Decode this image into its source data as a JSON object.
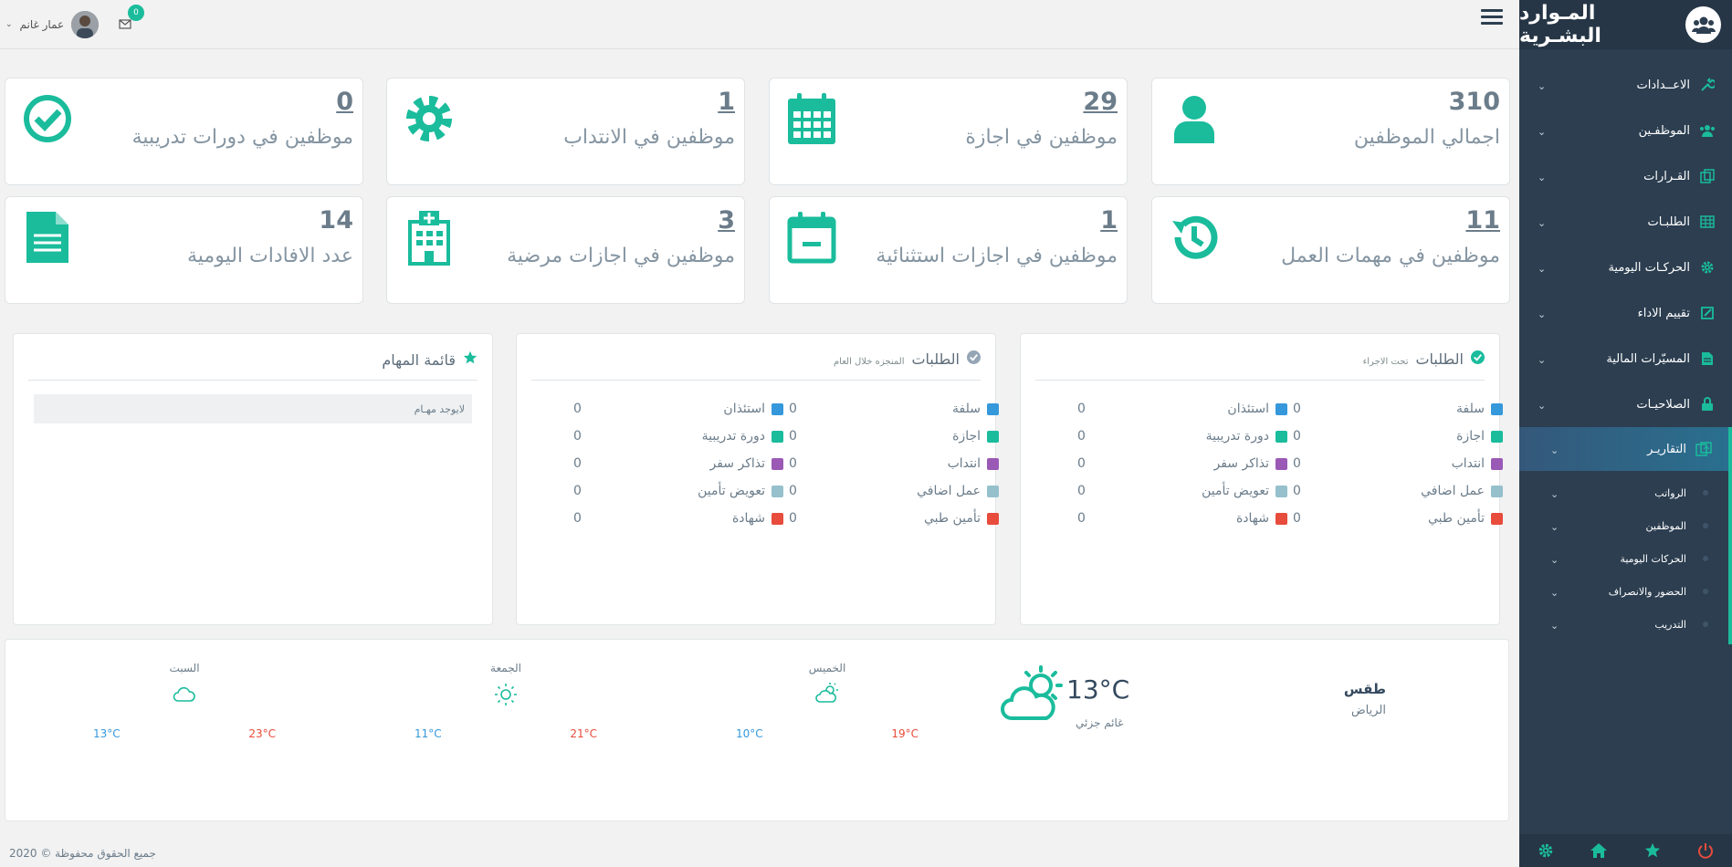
{
  "brand": {
    "title": "المـوارد البشـرية",
    "icon": "users-icon"
  },
  "topbar": {
    "user_name": "عمار غانم",
    "mail_count": "0"
  },
  "sidebar": {
    "items": [
      {
        "label": "الاعــدادات",
        "icon": "wrench-icon"
      },
      {
        "label": "الموظفـين",
        "icon": "users-icon"
      },
      {
        "label": "القـرارات",
        "icon": "copy-icon"
      },
      {
        "label": "الطلبـات",
        "icon": "table-icon"
      },
      {
        "label": "الحركـات اليومية",
        "icon": "gear-icon"
      },
      {
        "label": "تقييم الاداء",
        "icon": "edit-icon"
      },
      {
        "label": "المسيّرات المالية",
        "icon": "document-icon"
      },
      {
        "label": "الصلاحيـات",
        "icon": "lock-icon"
      },
      {
        "label": "التقاريـر",
        "icon": "reports-icon"
      }
    ],
    "subitems": [
      {
        "label": "الرواتب"
      },
      {
        "label": "الموظفين"
      },
      {
        "label": "الحركات اليومية"
      },
      {
        "label": "الحضور والانصراف"
      },
      {
        "label": "التدريب"
      }
    ]
  },
  "stats": [
    {
      "num": "310",
      "label": "اجمالي الموظفين",
      "icon": "user-icon",
      "underline": false
    },
    {
      "num": "29",
      "label": "موظفين في اجازة",
      "icon": "calendar-icon",
      "underline": true
    },
    {
      "num": "1",
      "label": "موظفين في الانتداب",
      "icon": "gear-icon",
      "underline": true
    },
    {
      "num": "0",
      "label": "موظفين في دورات تدريبية",
      "icon": "check-circle-icon",
      "underline": true
    },
    {
      "num": "11",
      "label": "موظفين في مهمات العمل",
      "icon": "history-icon",
      "underline": true
    },
    {
      "num": "1",
      "label": "موظفين في اجازات استثنائية",
      "icon": "calendar-minus-icon",
      "underline": true
    },
    {
      "num": "3",
      "label": "موظفين في اجازات مرضية",
      "icon": "hospital-icon",
      "underline": true
    },
    {
      "num": "14",
      "label": "عدد الافادات اليومية",
      "icon": "file-icon",
      "underline": false
    }
  ],
  "requests_pending": {
    "title": "الطلبات",
    "subtitle": "تحت الاجراء",
    "right_col": [
      {
        "name": "سلفة",
        "val": "0",
        "color": "#3498db"
      },
      {
        "name": "اجازة",
        "val": "0",
        "color": "#1abc9c"
      },
      {
        "name": "انتداب",
        "val": "0",
        "color": "#9b59b6"
      },
      {
        "name": "عمل اضافي",
        "val": "0",
        "color": "#95c0cc"
      },
      {
        "name": "تأمين طبي",
        "val": "0",
        "color": "#e74c3c"
      }
    ],
    "left_col": [
      {
        "name": "استئذان",
        "val": "0",
        "color": "#3498db"
      },
      {
        "name": "دورة تدريبية",
        "val": "0",
        "color": "#1abc9c"
      },
      {
        "name": "تذاكر سفر",
        "val": "0",
        "color": "#9b59b6"
      },
      {
        "name": "تعويض تأمين",
        "val": "0",
        "color": "#95c0cc"
      },
      {
        "name": "شهادة",
        "val": "0",
        "color": "#e74c3c"
      }
    ]
  },
  "requests_done": {
    "title": "الطلبات",
    "subtitle": "المنجزه خلال العام",
    "right_col": [
      {
        "name": "سلفة",
        "val": "0",
        "color": "#3498db"
      },
      {
        "name": "اجازة",
        "val": "0",
        "color": "#1abc9c"
      },
      {
        "name": "انتداب",
        "val": "0",
        "color": "#9b59b6"
      },
      {
        "name": "عمل اضافي",
        "val": "0",
        "color": "#95c0cc"
      },
      {
        "name": "تأمين طبي",
        "val": "0",
        "color": "#e74c3c"
      }
    ],
    "left_col": [
      {
        "name": "استئذان",
        "val": "0",
        "color": "#3498db"
      },
      {
        "name": "دورة تدريبية",
        "val": "0",
        "color": "#1abc9c"
      },
      {
        "name": "تذاكر سفر",
        "val": "0",
        "color": "#9b59b6"
      },
      {
        "name": "تعويض تأمين",
        "val": "0",
        "color": "#95c0cc"
      },
      {
        "name": "شهادة",
        "val": "0",
        "color": "#e74c3c"
      }
    ]
  },
  "tasks": {
    "title": "قائمة المهام",
    "empty": "لايوجد مهـام"
  },
  "weather": {
    "title": "طقس",
    "city": "الرياض",
    "temp": "13°C",
    "desc": "غائم جزئي",
    "days": [
      {
        "name": "الخميس",
        "hi": "19°C",
        "lo": "10°C",
        "icon": "cloud-sun-icon"
      },
      {
        "name": "الجمعة",
        "hi": "21°C",
        "lo": "11°C",
        "icon": "sun-icon"
      },
      {
        "name": "السبت",
        "hi": "23°C",
        "lo": "13°C",
        "icon": "cloud-icon"
      }
    ]
  },
  "footer": {
    "text": "جميع الحقوق محفوظة © 2020"
  },
  "colors": {
    "accent": "#1abc9c",
    "sidebar": "#2c3e50"
  }
}
